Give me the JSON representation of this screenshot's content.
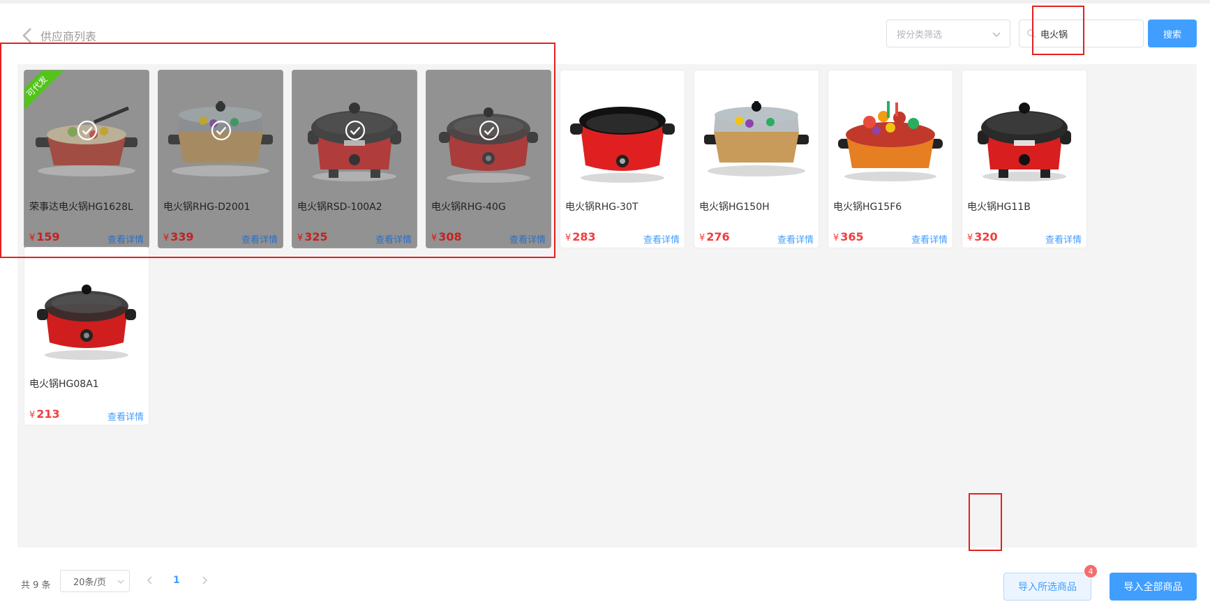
{
  "header": {
    "back_title": "供应商列表",
    "category_placeholder": "按分类筛选",
    "search_value": "电火锅",
    "search_button": "搜索"
  },
  "products": [
    {
      "name": "荣事达电火锅HG1628L",
      "price": "159",
      "detail": "查看详情",
      "selected": true,
      "ribbon": "可代发",
      "image": "square-hotpot-red-icon"
    },
    {
      "name": "电火锅RHG-D2001",
      "price": "339",
      "detail": "查看详情",
      "selected": true,
      "ribbon": "",
      "image": "square-hotpot-gold-icon"
    },
    {
      "name": "电火锅RSD-100A2",
      "price": "325",
      "detail": "查看详情",
      "selected": true,
      "ribbon": "",
      "image": "mickey-pot-red-icon"
    },
    {
      "name": "电火锅RHG-40G",
      "price": "308",
      "detail": "查看详情",
      "selected": true,
      "ribbon": "",
      "image": "round-pot-red-icon"
    },
    {
      "name": "电火锅RHG-30T",
      "price": "283",
      "detail": "查看详情",
      "selected": false,
      "ribbon": "",
      "image": "open-pot-red-icon"
    },
    {
      "name": "电火锅HG150H",
      "price": "276",
      "detail": "查看详情",
      "selected": false,
      "ribbon": "",
      "image": "square-hotpot-gold-icon"
    },
    {
      "name": "电火锅HG15F6",
      "price": "365",
      "detail": "查看详情",
      "selected": false,
      "ribbon": "",
      "image": "food-pot-orange-icon"
    },
    {
      "name": "电火锅HG11B",
      "price": "320",
      "detail": "查看详情",
      "selected": false,
      "ribbon": "",
      "image": "mickey-pot-red-icon"
    },
    {
      "name": "电火锅HG08A1",
      "price": "213",
      "detail": "查看详情",
      "selected": false,
      "ribbon": "",
      "image": "round-pot-red-icon"
    }
  ],
  "currency": "¥",
  "pagination": {
    "total_text": "共 9 条",
    "page_size": "20条/页",
    "current_page": "1"
  },
  "actions": {
    "import_selected": "导入所选商品",
    "selected_count": "4",
    "import_all": "导入全部商品"
  },
  "colors": {
    "primary": "#409eff",
    "price": "#f23c3c",
    "ribbon": "#52c41a",
    "annotation": "#e32020"
  }
}
